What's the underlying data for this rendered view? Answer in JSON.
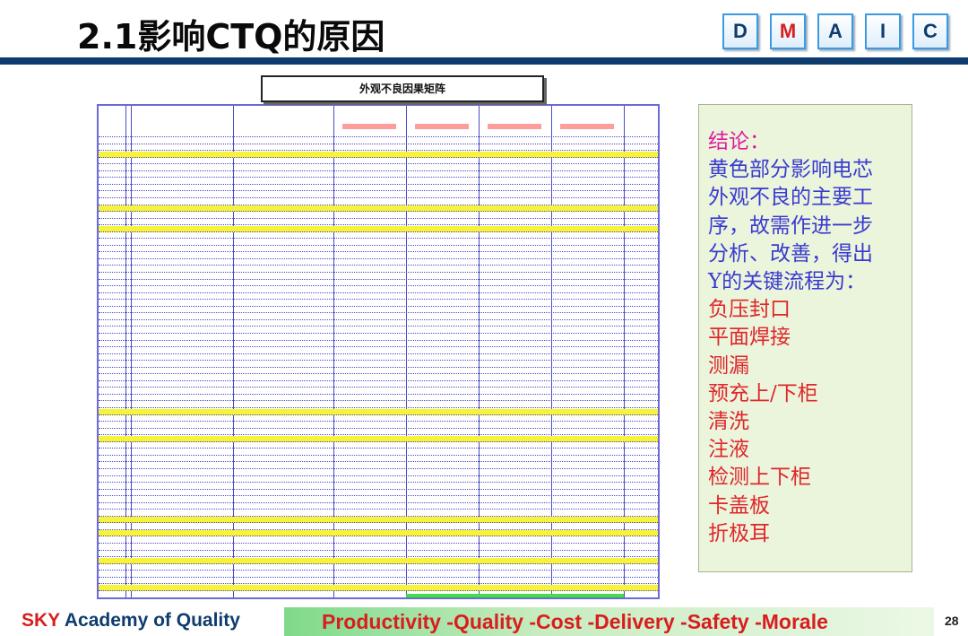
{
  "slide": {
    "title": "2.1影响CTQ的原因",
    "page_number": "28"
  },
  "dmaic": [
    {
      "letter": "D",
      "active": false
    },
    {
      "letter": "M",
      "active": true
    },
    {
      "letter": "A",
      "active": false
    },
    {
      "letter": "I",
      "active": false
    },
    {
      "letter": "C",
      "active": false
    }
  ],
  "matrix": {
    "title": "外观不良因果矩阵"
  },
  "conclusion": {
    "heading": "结论：",
    "body_lines": [
      "黄色部分影响电芯",
      "外观不良的主要工",
      "序，故需作进一步",
      "分析、改善，得出",
      "Y的关键流程为："
    ],
    "key_processes": [
      "负压封口",
      "平面焊接",
      "测漏",
      "预充上/下柜",
      "清洗",
      "注液",
      "检测上下柜",
      "卡盖板",
      "折极耳"
    ]
  },
  "footer": {
    "brand_sky": "SKY",
    "brand_rest": "Academy of Quality",
    "slogan": "Productivity  -Quality  -Cost   -Delivery  -Safety  -Morale"
  },
  "colors": {
    "navy": "#0e3c6e",
    "red": "#d81e1e",
    "magenta": "#e01aa0",
    "blue_text": "#3a3ad0",
    "highlight_yellow": "#f7f23a",
    "panel_green": "#ebf5dc"
  }
}
